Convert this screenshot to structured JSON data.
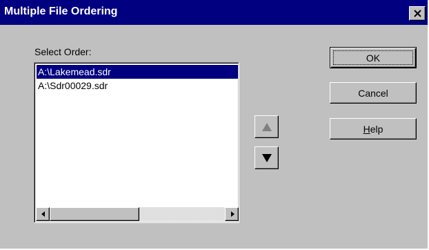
{
  "window": {
    "title": "Multiple File Ordering"
  },
  "list": {
    "label": "Select Order:",
    "items": [
      {
        "label": "A:\\Lakemead.sdr",
        "selected": true
      },
      {
        "label": "A:\\Sdr00029.sdr",
        "selected": false
      }
    ]
  },
  "order_controls": {
    "move_up_icon": "triangle-up-icon",
    "move_up_enabled": false,
    "move_down_icon": "triangle-down-icon",
    "move_down_enabled": true
  },
  "buttons": {
    "ok_label": "OK",
    "cancel_label": "Cancel",
    "help_mnemonic": "H",
    "help_rest": "elp"
  },
  "colors": {
    "face": "#c0c0c0",
    "titlebar": "#000080",
    "selection": "#000080",
    "disabled_arrow": "#808080"
  }
}
